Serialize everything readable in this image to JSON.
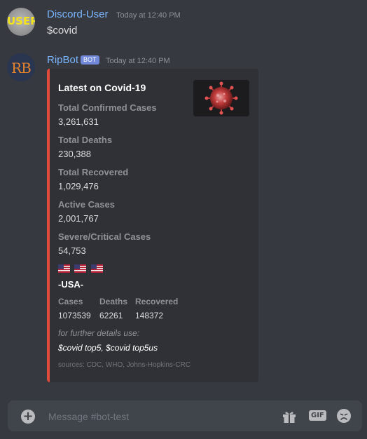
{
  "messages": [
    {
      "username": "Discord-User",
      "timestamp": "Today at 12:40 PM",
      "text": "$covid",
      "avatar_text": "USER"
    },
    {
      "username": "RipBot",
      "badge": "BOT",
      "timestamp": "Today at 12:40 PM",
      "avatar_text": "RB"
    }
  ],
  "embed": {
    "accent_color": "#e04b3a",
    "title": "Latest on Covid-19",
    "thumbnail_icon": "coronavirus-image",
    "fields": [
      {
        "name": "Total Confirmed Cases",
        "value": "3,261,631"
      },
      {
        "name": "Total Deaths",
        "value": "230,388"
      },
      {
        "name": "Total Recovered",
        "value": "1,029,476"
      },
      {
        "name": "Active Cases",
        "value": "2,001,767"
      },
      {
        "name": "Severe/Critical Cases",
        "value": "54,753"
      }
    ],
    "flags": [
      "us-flag",
      "us-flag",
      "us-flag"
    ],
    "country": "-USA-",
    "columns": [
      {
        "name": "Cases",
        "value": "1073539"
      },
      {
        "name": "Deaths",
        "value": "62261"
      },
      {
        "name": "Recovered",
        "value": "148372"
      }
    ],
    "footer_hint": "for further details use:",
    "footer_commands": "$covid top5, $covid top5us",
    "sources": "sources: CDC, WHO, Johns-Hopkins-CRC"
  },
  "composer": {
    "placeholder": "Message #bot-test",
    "gif_label": "GIF",
    "icons": [
      "add-icon",
      "gift-icon",
      "gif-icon",
      "emoji-icon"
    ]
  },
  "colors": {
    "background": "#36393f",
    "username": "#7ab6ff",
    "bot_badge": "#7289da"
  }
}
